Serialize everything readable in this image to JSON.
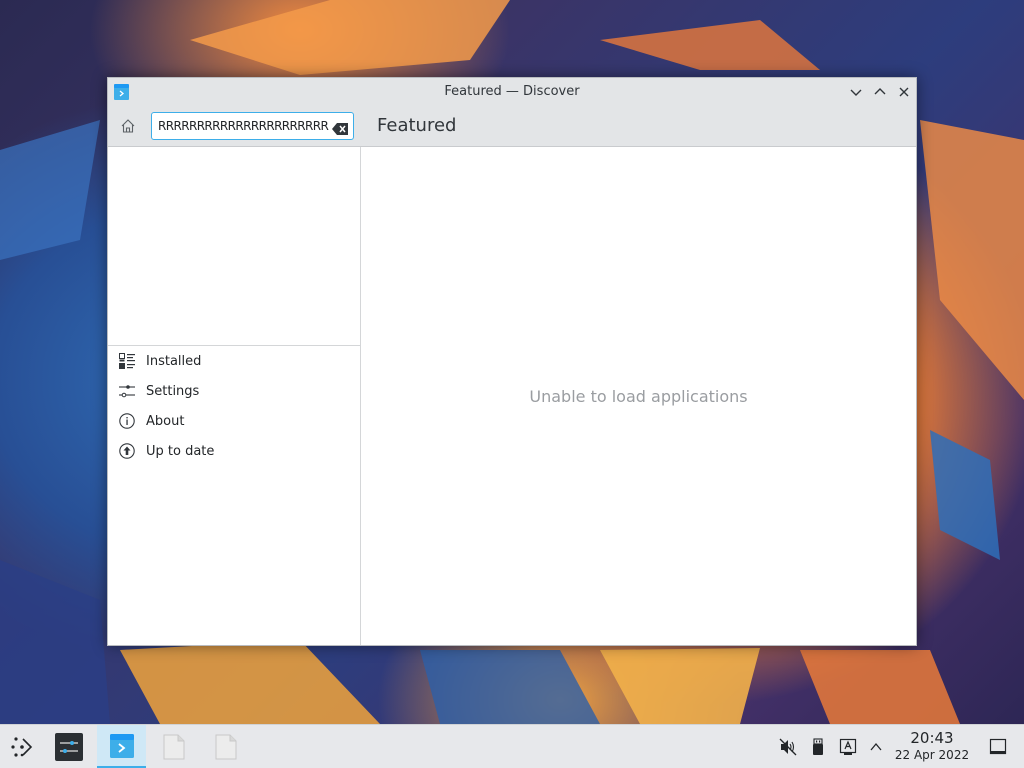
{
  "window": {
    "title": "Featured — Discover",
    "controls": {
      "minimize_icon": "chevron-down-icon",
      "maximize_icon": "chevron-up-icon",
      "close_icon": "close-icon"
    }
  },
  "toolbar": {
    "home_icon": "home-icon",
    "search": {
      "value": "RRRRRRRRRRRRRRRRRRRRRR",
      "placeholder": ""
    },
    "clear_icon": "clear-text-icon",
    "page_heading": "Featured"
  },
  "sidebar": {
    "items": [
      {
        "label": "Installed",
        "icon": "installed-icon"
      },
      {
        "label": "Settings",
        "icon": "settings-icon"
      },
      {
        "label": "About",
        "icon": "info-icon"
      },
      {
        "label": "Up to date",
        "icon": "update-icon"
      }
    ]
  },
  "main": {
    "message": "Unable to load applications"
  },
  "taskbar": {
    "launcher_icon": "app-launcher-icon",
    "tasks": [
      {
        "name": "system-settings",
        "icon": "settings-sliders-icon",
        "active": false
      },
      {
        "name": "discover",
        "icon": "discover-icon",
        "active": true
      },
      {
        "name": "file-1",
        "icon": "document-icon",
        "active": false
      },
      {
        "name": "file-2",
        "icon": "document-icon",
        "active": false
      }
    ],
    "tray": {
      "icons": [
        "volume-muted-icon",
        "removable-device-icon",
        "update-notifier-icon",
        "show-hidden-icons-icon"
      ]
    },
    "clock": {
      "time": "20:43",
      "date": "22 Apr 2022"
    },
    "show_desktop_icon": "show-desktop-icon"
  },
  "colors": {
    "accent": "#3daee9",
    "window_bg": "#ffffff",
    "titlebar_bg": "#e3e5e7",
    "muted_text": "#9a9da1"
  }
}
